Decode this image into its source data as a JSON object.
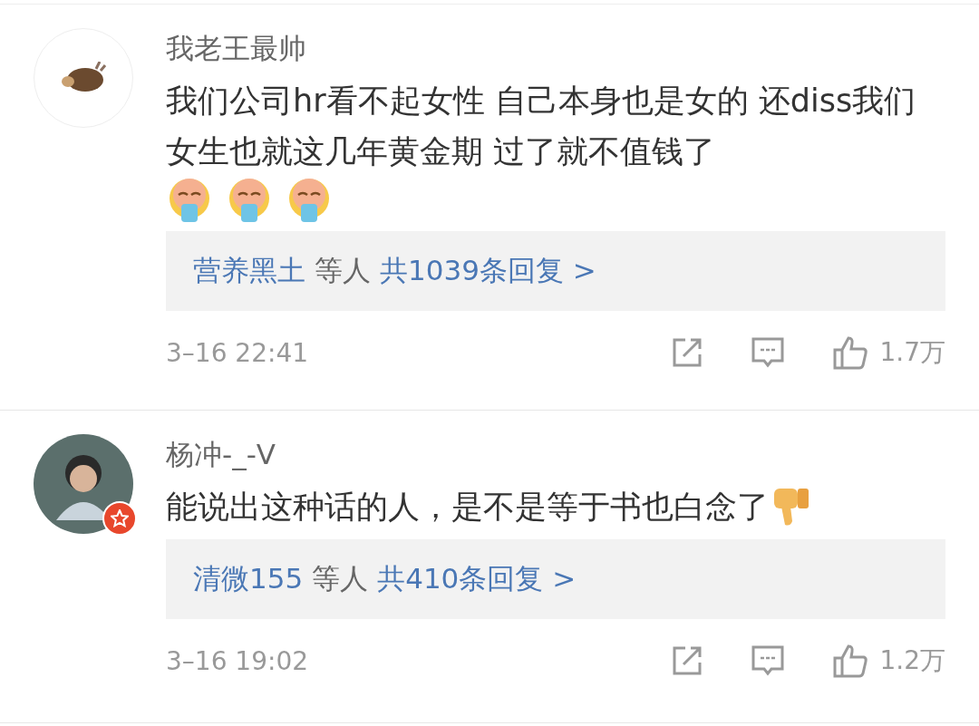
{
  "comments": [
    {
      "user": "我老王最帅",
      "kind": "cartoon",
      "verified": false,
      "text": "我们公司hr看不起女性  自己本身也是女的  还diss我们女生也就这几年黄金期  过了就不值钱了",
      "emojis": [
        {
          "kind": "vomit"
        },
        {
          "kind": "vomit"
        },
        {
          "kind": "vomit"
        }
      ],
      "replies": {
        "names": "营养黑土",
        "suffix": "等人",
        "count": "共1039条回复 >"
      },
      "time": "3–16 22:41",
      "likes": "1.7万"
    },
    {
      "user": "杨冲-_-V",
      "kind": "photo",
      "verified": true,
      "text": "能说出这种话的人，是不是等于书也白念了",
      "emojis": [
        {
          "kind": "thumbs-down"
        }
      ],
      "replies": {
        "names": "清微155",
        "suffix": "等人",
        "count": "共410条回复 >"
      },
      "time": "3–16 19:02",
      "likes": "1.2万"
    }
  ]
}
